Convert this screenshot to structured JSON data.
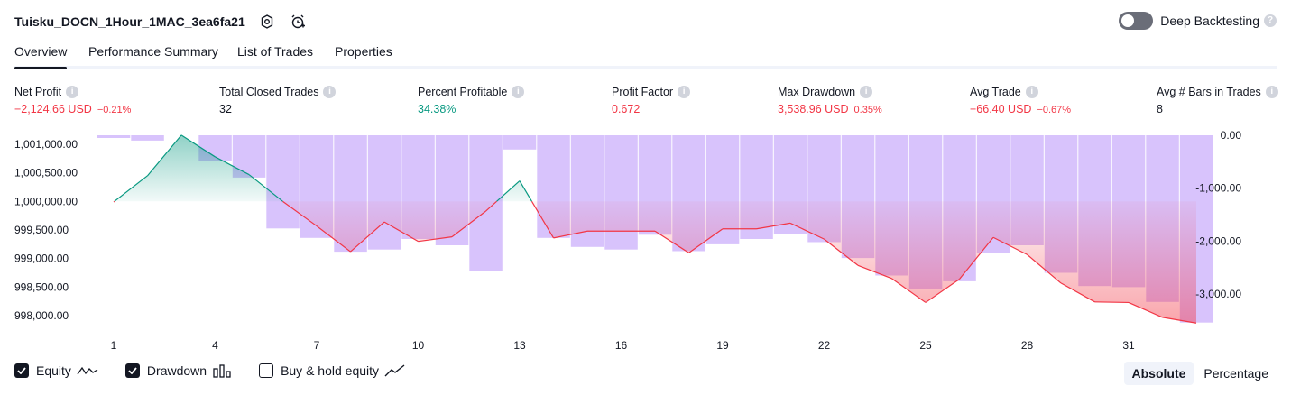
{
  "header": {
    "title": "Tuisku_DOCN_1Hour_1MAC_3ea6fa21",
    "deep_backtesting_label": "Deep Backtesting",
    "deep_backtesting_enabled": false
  },
  "tabs": [
    "Overview",
    "Performance Summary",
    "List of Trades",
    "Properties"
  ],
  "active_tab": "Overview",
  "metrics": [
    {
      "label": "Net Profit",
      "value": "−2,124.66 USD",
      "sub": "−0.21%",
      "color": "#f23645"
    },
    {
      "label": "Total Closed Trades",
      "value": "32",
      "sub": "",
      "color": "#131722"
    },
    {
      "label": "Percent Profitable",
      "value": "34.38%",
      "sub": "",
      "color": "#089981"
    },
    {
      "label": "Profit Factor",
      "value": "0.672",
      "sub": "",
      "color": "#f23645"
    },
    {
      "label": "Max Drawdown",
      "value": "3,538.96 USD",
      "sub": "0.35%",
      "color": "#f23645"
    },
    {
      "label": "Avg Trade",
      "value": "−66.40 USD",
      "sub": "−0.67%",
      "color": "#f23645"
    },
    {
      "label": "Avg # Bars in Trades",
      "value": "8",
      "sub": "",
      "color": "#131722"
    }
  ],
  "chart_data": {
    "type": "line",
    "x_ticks": [
      "1",
      "4",
      "7",
      "10",
      "13",
      "16",
      "19",
      "22",
      "25",
      "28",
      "31"
    ],
    "left_axis_ticks": [
      "1,001,000.00",
      "1,000,500.00",
      "1,000,000.00",
      "999,500.00",
      "999,000.00",
      "998,500.00",
      "998,000.00"
    ],
    "right_axis_ticks": [
      "0.00",
      "-1,000.00",
      "-2,000.00",
      "-3,000.00"
    ],
    "series": [
      {
        "name": "Equity",
        "type": "line",
        "color": "#f23645",
        "profit_color": "#089981",
        "x": [
          1,
          2,
          3,
          4,
          5,
          6,
          7,
          8,
          9,
          10,
          11,
          12,
          13,
          14,
          15,
          16,
          17,
          18,
          19,
          20,
          21,
          22,
          23,
          24,
          25,
          26,
          27,
          28,
          29,
          30,
          31,
          32,
          33
        ],
        "values": [
          999990,
          1000450,
          1001160,
          1000780,
          1000470,
          1000000,
          999570,
          999120,
          999640,
          999300,
          999380,
          999830,
          1000360,
          999360,
          999480,
          999480,
          999480,
          999100,
          999520,
          999520,
          999620,
          999340,
          998880,
          998650,
          998230,
          998640,
          999370,
          999070,
          998570,
          998240,
          998230,
          997970,
          997870
        ]
      },
      {
        "name": "Drawdown",
        "type": "bar",
        "color": "#d1b8fb",
        "values": [
          -30,
          -100,
          0,
          -490,
          -800,
          -1760,
          -1940,
          -2200,
          -2160,
          -1960,
          -2080,
          -2560,
          -270,
          -1940,
          -2110,
          -2160,
          -1880,
          -2190,
          -2060,
          -1960,
          -1870,
          -2020,
          -2320,
          -2650,
          -2910,
          -2760,
          -2230,
          -2080,
          -2600,
          -2850,
          -2870,
          -3150,
          -3540
        ]
      }
    ],
    "left_ylim": [
      997800,
      1001200
    ],
    "right_ylim": [
      -3600,
      100
    ]
  },
  "legend": [
    {
      "label": "Equity",
      "checked": true,
      "icon": "equity-line-icon"
    },
    {
      "label": "Drawdown",
      "checked": true,
      "icon": "drawdown-bars-icon"
    },
    {
      "label": "Buy & hold equity",
      "checked": false,
      "icon": "buy-hold-line-icon"
    }
  ],
  "modes": [
    "Absolute",
    "Percentage"
  ],
  "selected_mode": "Absolute"
}
